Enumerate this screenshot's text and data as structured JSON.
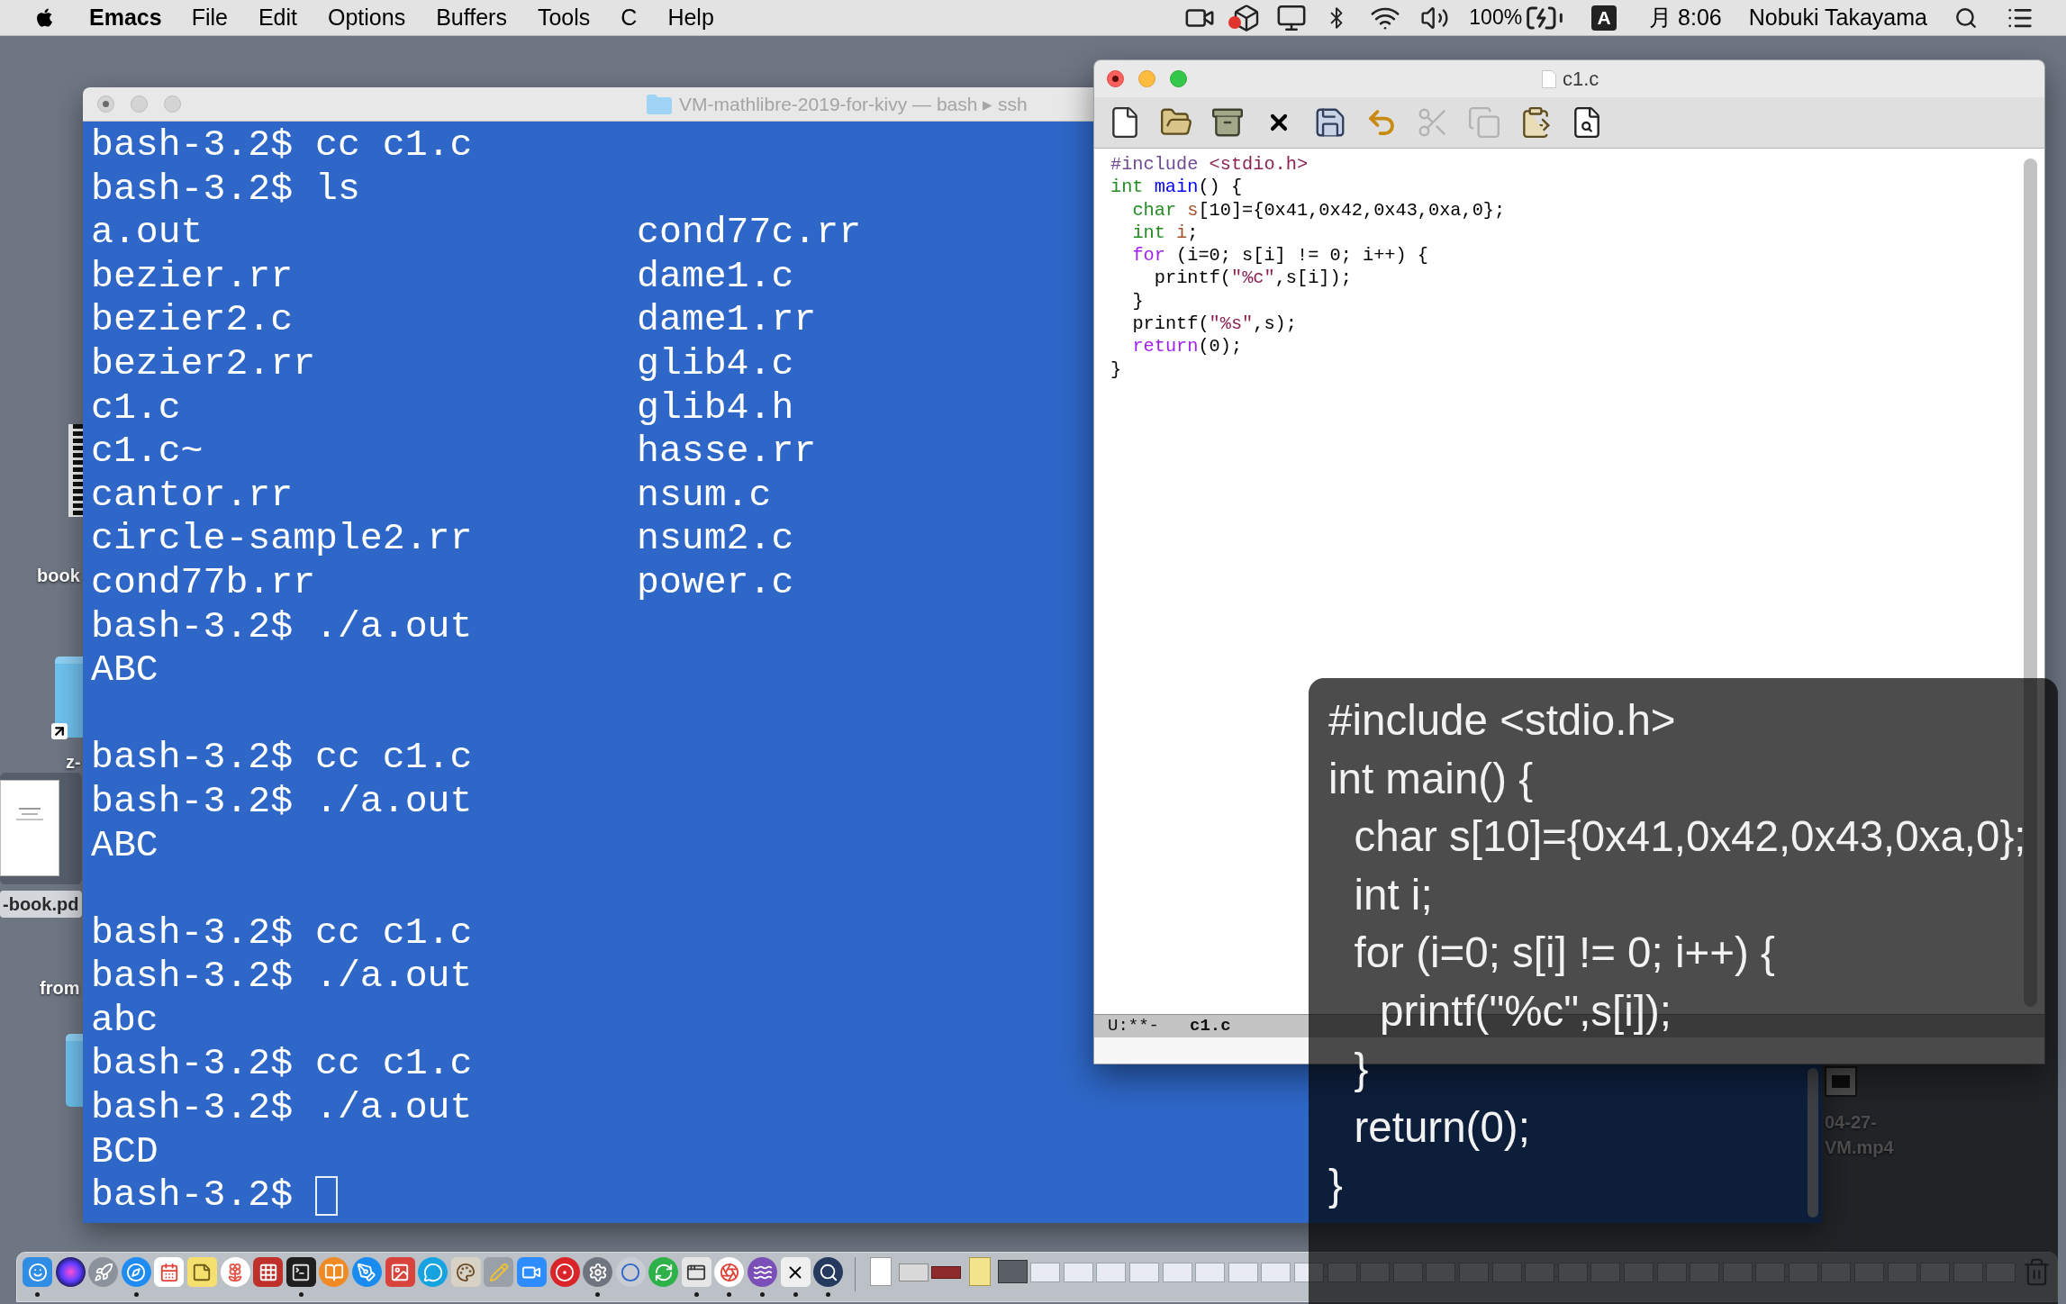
{
  "menubar": {
    "app": "Emacs",
    "menus": [
      "File",
      "Edit",
      "Options",
      "Buffers",
      "Tools",
      "C",
      "Help"
    ],
    "battery": "100%",
    "input_source": "A",
    "clock": "月 8:06",
    "user": "Nobuki Takayama"
  },
  "desktop_items": [
    {
      "kind": "strip",
      "label": "book",
      "selected": false
    },
    {
      "kind": "alias",
      "label": "z-",
      "selected": false
    },
    {
      "kind": "pdf",
      "label": "-book.pd",
      "selected": true
    },
    {
      "kind": "hidden",
      "label": "from",
      "selected": false
    },
    {
      "kind": "folder",
      "selected": false
    },
    {
      "kind": "video",
      "label": "04-27-VM.mp4",
      "selected": false
    }
  ],
  "terminal": {
    "title": "VM-mathlibre-2019-for-kivy — bash ▸ ssh",
    "active": false,
    "edited": true,
    "lines": [
      {
        "kind": "text",
        "text": "bash-3.2$ cc c1.c"
      },
      {
        "kind": "text",
        "text": "bash-3.2$ ls"
      },
      {
        "kind": "columns",
        "columns": [
          "a.out",
          "cond77c.rr"
        ]
      },
      {
        "kind": "columns",
        "columns": [
          "bezier.rr",
          "dame1.c"
        ]
      },
      {
        "kind": "columns",
        "columns": [
          "bezier2.c",
          "dame1.rr"
        ]
      },
      {
        "kind": "columns",
        "columns": [
          "bezier2.rr",
          "glib4.c"
        ]
      },
      {
        "kind": "columns",
        "columns": [
          "c1.c",
          "glib4.h"
        ]
      },
      {
        "kind": "columns",
        "columns": [
          "c1.c~",
          "hasse.rr"
        ]
      },
      {
        "kind": "columns",
        "columns": [
          "cantor.rr",
          "nsum.c"
        ]
      },
      {
        "kind": "columns",
        "columns": [
          "circle-sample2.rr",
          "nsum2.c"
        ]
      },
      {
        "kind": "columns",
        "columns": [
          "cond77b.rr",
          "power.c"
        ]
      },
      {
        "kind": "text",
        "text": "bash-3.2$ ./a.out"
      },
      {
        "kind": "text",
        "text": "ABC"
      },
      {
        "kind": "blank"
      },
      {
        "kind": "text",
        "text": "bash-3.2$ cc c1.c"
      },
      {
        "kind": "text",
        "text": "bash-3.2$ ./a.out"
      },
      {
        "kind": "text",
        "text": "ABC"
      },
      {
        "kind": "blank"
      },
      {
        "kind": "text",
        "text": "bash-3.2$ cc c1.c"
      },
      {
        "kind": "text",
        "text": "bash-3.2$ ./a.out"
      },
      {
        "kind": "text",
        "text": "abc"
      },
      {
        "kind": "text",
        "text": "bash-3.2$ cc c1.c"
      },
      {
        "kind": "text",
        "text": "bash-3.2$ ./a.out"
      },
      {
        "kind": "text",
        "text": "BCD"
      },
      {
        "kind": "prompt",
        "text": "bash-3.2$"
      }
    ]
  },
  "editor": {
    "title": "c1.c",
    "active": true,
    "edited": true,
    "toolbar": [
      {
        "kind": "new",
        "disabled": false
      },
      {
        "kind": "open",
        "disabled": false
      },
      {
        "kind": "dired",
        "disabled": false
      },
      {
        "kind": "close",
        "disabled": false
      },
      {
        "kind": "save",
        "disabled": false
      },
      {
        "kind": "undo",
        "disabled": false
      },
      {
        "kind": "cut",
        "disabled": true
      },
      {
        "kind": "copy",
        "disabled": true
      },
      {
        "kind": "paste",
        "disabled": false
      },
      {
        "kind": "search",
        "disabled": false
      }
    ],
    "code": [
      {
        "tokens": [
          {
            "kind": "preprocessor",
            "text": "#include "
          },
          {
            "kind": "string",
            "text": "<stdio.h>"
          }
        ]
      },
      {
        "tokens": [
          {
            "kind": "type",
            "text": "int "
          },
          {
            "kind": "function",
            "text": "main"
          },
          {
            "kind": "plain",
            "text": "() {"
          }
        ],
        "children": [
          {
            "tokens": [
              {
                "kind": "type",
                "text": "char "
              },
              {
                "kind": "variable",
                "text": "s"
              },
              {
                "kind": "plain",
                "text": "[10]={0x41,0x42,0x43,0xa,0};"
              }
            ]
          },
          {
            "tokens": [
              {
                "kind": "type",
                "text": "int "
              },
              {
                "kind": "variable",
                "text": "i"
              },
              {
                "kind": "plain",
                "text": ";"
              }
            ]
          },
          {
            "tokens": [
              {
                "kind": "keyword",
                "text": "for"
              },
              {
                "kind": "plain",
                "text": " (i=0; s[i] != 0; i++) {"
              }
            ],
            "children": [
              {
                "tokens": [
                  {
                    "kind": "plain",
                    "text": "printf("
                  },
                  {
                    "kind": "string",
                    "text": "\"%c\""
                  },
                  {
                    "kind": "plain",
                    "text": ",s[i]);"
                  }
                ]
              }
            ]
          },
          {
            "tokens": [
              {
                "kind": "plain",
                "text": "}"
              }
            ]
          },
          {
            "tokens": [
              {
                "kind": "plain",
                "text": "printf("
              },
              {
                "kind": "string",
                "text": "\"%s\""
              },
              {
                "kind": "plain",
                "text": ",s);"
              }
            ]
          },
          {
            "tokens": [
              {
                "kind": "keyword",
                "text": "return"
              },
              {
                "kind": "plain",
                "text": "(0);"
              }
            ]
          }
        ]
      },
      {
        "tokens": [
          {
            "kind": "plain",
            "text": "}"
          }
        ]
      }
    ],
    "modeline": {
      "status": "U:**-",
      "buffer": "c1.c"
    }
  },
  "overlay": {
    "lines": [
      {
        "text": "#include <stdio.h>"
      },
      {
        "text": "int main() {",
        "children": [
          {
            "text": "char s[10]={0x41,0x42,0x43,0xa,0};"
          },
          {
            "text": "int i;"
          },
          {
            "text": "for (i=0; s[i] != 0; i++) {",
            "children": [
              {
                "text": "printf(\"%c\",s[i]);"
              }
            ]
          },
          {
            "text": "}"
          },
          {
            "text": "return(0);"
          }
        ]
      },
      {
        "text": "}"
      }
    ]
  },
  "dock": {
    "apps": [
      {
        "kind": "face",
        "running": true
      },
      {
        "kind": "orb",
        "running": false
      },
      {
        "kind": "rocket",
        "running": false
      },
      {
        "kind": "compass",
        "running": true
      },
      {
        "kind": "calendar",
        "running": false
      },
      {
        "kind": "note",
        "running": false
      },
      {
        "kind": "flower",
        "running": false
      },
      {
        "kind": "grid",
        "running": false
      },
      {
        "kind": "terminal",
        "running": true
      },
      {
        "kind": "book",
        "running": false
      },
      {
        "kind": "pen",
        "running": false
      },
      {
        "kind": "image",
        "running": false
      },
      {
        "kind": "chat",
        "running": false
      },
      {
        "kind": "palette",
        "running": false
      },
      {
        "kind": "pencil",
        "running": false
      },
      {
        "kind": "camera",
        "running": false
      },
      {
        "kind": "target",
        "running": false
      },
      {
        "kind": "gear",
        "running": true
      },
      {
        "kind": "ring",
        "running": false
      },
      {
        "kind": "loop",
        "running": false
      },
      {
        "kind": "window",
        "running": true
      },
      {
        "kind": "aperture",
        "running": true
      },
      {
        "kind": "waves",
        "running": true
      },
      {
        "kind": "cross",
        "running": true
      },
      {
        "kind": "magnifier",
        "running": true
      }
    ]
  }
}
